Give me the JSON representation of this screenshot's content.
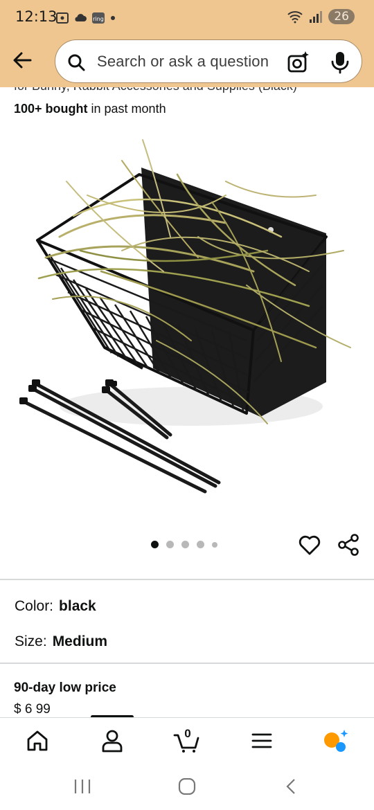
{
  "status": {
    "time": "12:13",
    "battery": "26"
  },
  "search": {
    "placeholder": "Search or ask a question"
  },
  "product": {
    "title_fragment": "for Bunny, Rabbit Accessories and Supplies (Black)",
    "bought_bold": "100+ bought",
    "bought_rest": " in past month",
    "image_dots_total": 5,
    "image_dots_active": 1
  },
  "attributes": {
    "color_label": "Color:",
    "color_value": "black",
    "size_label": "Size:",
    "size_value": "Medium"
  },
  "price": {
    "label": "90-day low price",
    "partial": "$ 6 99"
  },
  "bottom_nav": {
    "items": [
      "home-icon",
      "account-icon",
      "cart-icon",
      "menu-icon",
      "rufus-icon"
    ],
    "cart_count": "0"
  },
  "colors": {
    "header_bg": "#f0c690",
    "rufus_orange": "#ff9900",
    "rufus_blue": "#1a98ff"
  }
}
